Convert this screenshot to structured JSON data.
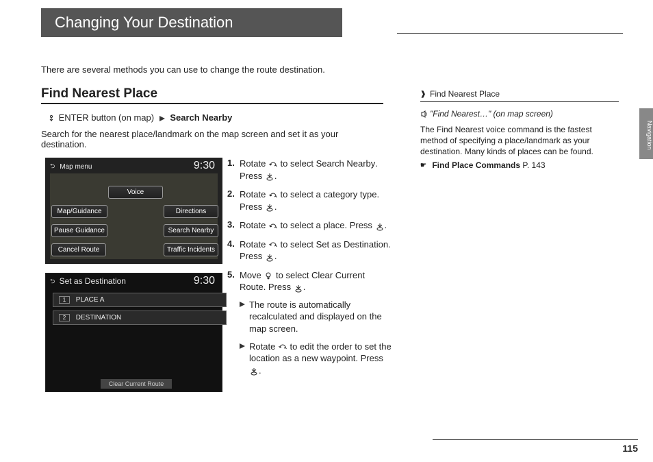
{
  "header": {
    "title": "Changing Your Destination"
  },
  "intro": "There are several methods you can use to change the route destination.",
  "subhead": "Find Nearest Place",
  "entry": {
    "prefix": "ENTER button (on map)",
    "action": "Search Nearby"
  },
  "desc": "Search for the nearest place/landmark on the map screen and set it as your destination.",
  "screen1": {
    "title": "Map menu",
    "clock": "9:30",
    "buttons": {
      "voice": "Voice",
      "mapguidance": "Map/Guidance",
      "directions": "Directions",
      "pausegui": "Pause Guidance",
      "searchnearby": "Search Nearby",
      "cancelroute": "Cancel Route",
      "traffic": "Traffic Incidents"
    }
  },
  "screen2": {
    "title": "Set as Destination",
    "clock": "9:30",
    "row1_flag": "1",
    "row1": "PLACE A",
    "row2_flag": "2",
    "row2": "DESTINATION",
    "button": "Clear Current Route"
  },
  "steps": [
    {
      "num": "1.",
      "pre": "Rotate ",
      "mid": " to select ",
      "kw": "Search Nearby",
      "post": ". Press ",
      "end": "."
    },
    {
      "num": "2.",
      "pre": "Rotate ",
      "mid": " to select a category type. Press ",
      "end": "."
    },
    {
      "num": "3.",
      "pre": "Rotate ",
      "mid": " to select a place. Press ",
      "end": "."
    },
    {
      "num": "4.",
      "pre": "Rotate ",
      "mid": " to select ",
      "kw": "Set as Destination",
      "post": ". Press ",
      "end": "."
    },
    {
      "num": "5.",
      "pre": "Move ",
      "mid": " to select ",
      "kw": "Clear Current Route",
      "post": ". Press ",
      "end": "."
    }
  ],
  "sub": [
    "The route is automatically recalculated and displayed on the map screen.",
    {
      "pre": "Rotate ",
      "mid": " to edit the order to set the location as a new waypoint. Press ",
      "end": "."
    }
  ],
  "sidebar": {
    "head": "Find Nearest Place",
    "quote": "\"Find Nearest…\"",
    "quote_suffix": " (on map screen)",
    "body": "The Find Nearest voice command is the fastest method of specifying a place/landmark as your destination. Many kinds of places can be found.",
    "link": "Find Place Commands",
    "page": "P. 143"
  },
  "tab": "Navigation",
  "pagenum": "115"
}
